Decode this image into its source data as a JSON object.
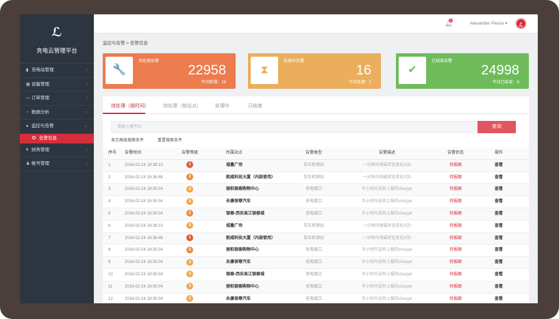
{
  "app": {
    "logo_mark": "ℒ",
    "title": "充电云管理平台"
  },
  "sidebar": {
    "items": [
      {
        "icon": "bar-chart-icon",
        "glyph": "▮",
        "label": "充电站管理"
      },
      {
        "icon": "device-icon",
        "glyph": "▦",
        "label": "设备管理"
      },
      {
        "icon": "order-icon",
        "glyph": "▭",
        "label": "订单管理"
      },
      {
        "icon": "pie-icon",
        "glyph": "◔",
        "label": "数据分析"
      },
      {
        "icon": "chat-icon",
        "glyph": "●",
        "label": "监控与告警"
      },
      {
        "icon": "finance-icon",
        "glyph": "¥",
        "label": "财务管理"
      },
      {
        "icon": "user-icon",
        "glyph": "♟",
        "label": "帐号管理"
      }
    ],
    "sub_active": "告警信息"
  },
  "header": {
    "bell_count": "2",
    "user_name": "Alexander Pierce ▾",
    "avatar_letter": "ℒ"
  },
  "breadcrumb": "监控与告警 > 告警信息",
  "cards": [
    {
      "title": "待处理告警",
      "number": "22958",
      "sub": "今日新增：26",
      "icon": "wrench-icon",
      "glyph": "🔧",
      "color": "#ec7b4d"
    },
    {
      "title": "处理中告警",
      "number": "16",
      "sub": "今日处理：2",
      "icon": "hourglass-icon",
      "glyph": "⧗",
      "color": "#eaae5c"
    },
    {
      "title": "已结束告警",
      "number": "24998",
      "sub": "今日已结束：6",
      "icon": "check-icon",
      "glyph": "✔",
      "color": "#6fbb5c"
    }
  ],
  "tabs": [
    "待处理（按时间）",
    "待处理（按站点）",
    "处理中",
    "已结束"
  ],
  "search": {
    "placeholder": "请输入爆件ID",
    "button": "查询",
    "advanced": "显示高级搜索条件",
    "reset": "重置搜索条件"
  },
  "table": {
    "headers": [
      "序号",
      "告警时间",
      "告警等级",
      "所属站点",
      "告警类型",
      "告警描述",
      "告警状态",
      "操作"
    ],
    "rows": [
      [
        "1",
        "2016-02-24 18:38:10",
        "1",
        "城量广场",
        "车位检测仪",
        "一分钟内地磁状态变化3次r",
        "待报跟",
        "查看"
      ],
      [
        "2",
        "2016-02-24 18:36:48",
        "2",
        "航威科技大厦（内部使用）",
        "车位检测仪",
        "一分钟内地磁状态变化3次r",
        "待报跟",
        "查看"
      ],
      [
        "3",
        "2016-02-24 18:30:04",
        "3",
        "丽柏银泰购物中心",
        "充电接口",
        "半小时内没有上报的charger",
        "待报跟",
        "查看"
      ],
      [
        "4",
        "2016-02-24 18:30:04",
        "3",
        "永康保尊汽车",
        "充电接口",
        "半小时内没有上报的charger",
        "待报跟",
        "查看"
      ],
      [
        "5",
        "2016-02-24 18:30:04",
        "2",
        "银泰-西安县江银泰城",
        "充电接口",
        "半小时内没有上报的charger",
        "待报跟",
        "查看"
      ],
      [
        "6",
        "2016-02-24 18:38:10",
        "3",
        "城量广场",
        "车位检测仪",
        "一分钟内地磁状态变化3次r",
        "待报跟",
        "查看"
      ],
      [
        "7",
        "2016-02-24 18:36:48",
        "1",
        "航威科技大厦（内部使用）",
        "车位检测仪",
        "一分钟内地磁状态变化3次r",
        "待报跟",
        "查看"
      ],
      [
        "8",
        "2016-02-24 18:30:04",
        "2",
        "丽柏银泰购物中心",
        "充电接口",
        "半小时内没有上报的charger",
        "待报跟",
        "查看"
      ],
      [
        "9",
        "2016-02-24 18:30:04",
        "3",
        "永康保尊汽车",
        "充电接口",
        "半小时内没有上报的charger",
        "待报跟",
        "查看"
      ],
      [
        "10",
        "2016-02-24 18:30:04",
        "3",
        "银泰-西安县江银泰城",
        "充电接口",
        "半小时内没有上报的charger",
        "待报跟",
        "查看"
      ],
      [
        "11",
        "2016-02-24 18:30:04",
        "3",
        "丽柏银泰购物中心",
        "充电接口",
        "半小时内没有上报的charger",
        "待报跟",
        "查看"
      ],
      [
        "12",
        "2016-02-24 18:30:04",
        "3",
        "永康保尊汽车",
        "充电接口",
        "半小时内没有上报的charger",
        "待报跟",
        "查看"
      ]
    ]
  },
  "colors": {
    "accent": "#d62d3a",
    "sidebar": "#2c3540",
    "status_text": "#d62d3a"
  }
}
